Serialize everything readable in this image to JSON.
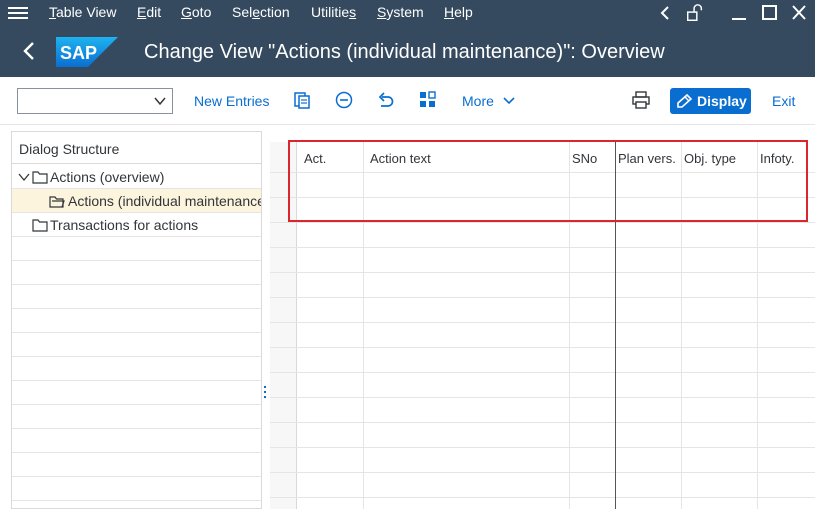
{
  "menu": {
    "items": [
      {
        "pre": "",
        "ul": "T",
        "post": "able View"
      },
      {
        "pre": "",
        "ul": "E",
        "post": "dit"
      },
      {
        "pre": "",
        "ul": "G",
        "post": "oto"
      },
      {
        "pre": "Sel",
        "ul": "e",
        "post": "ction"
      },
      {
        "pre": "Utilitie",
        "ul": "s",
        "post": ""
      },
      {
        "pre": "",
        "ul": "S",
        "post": "ystem"
      },
      {
        "pre": "",
        "ul": "H",
        "post": "elp"
      }
    ],
    "icons": [
      "back-chevron-icon",
      "unlock-icon",
      "minimize-icon",
      "maximize-icon",
      "close-icon"
    ]
  },
  "title_bar": {
    "logo_text": "SAP",
    "title": "Change View \"Actions (individual maintenance)\": Overview"
  },
  "toolbar": {
    "combo_value": "",
    "new_entries_label": "New Entries",
    "more_label": "More",
    "display_label": "Display",
    "exit_label": "Exit"
  },
  "dialog_structure": {
    "header": "Dialog Structure",
    "items": [
      {
        "label": "Actions (overview)",
        "level": 0,
        "expanded": true,
        "selected": false
      },
      {
        "label": "Actions (individual maintenance)",
        "level": 1,
        "expanded": false,
        "selected": true
      },
      {
        "label": "Transactions for actions",
        "level": 0,
        "expanded": false,
        "selected": false
      }
    ]
  },
  "table": {
    "columns": [
      "Act.",
      "Action text",
      "SNo",
      "Plan vers.",
      "Obj. type",
      "Infoty."
    ],
    "rows": []
  },
  "colors": {
    "shell": "#354a5f",
    "accent": "#0a6ed1",
    "highlight": "#d9272d",
    "selected_row": "#fcf4dd"
  }
}
